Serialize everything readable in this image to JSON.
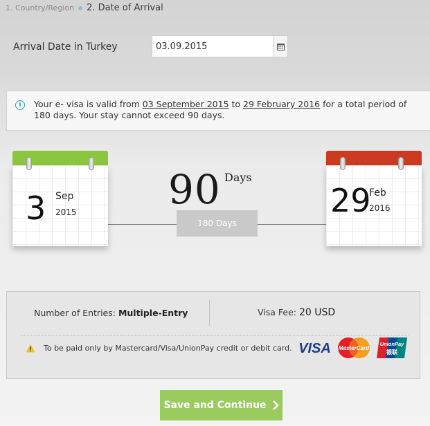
{
  "steps": {
    "step1": "1. Country/Region",
    "step2": "2. Date of Arrival"
  },
  "arrival": {
    "label": "Arrival Date in Turkey",
    "value": "03.09.2015"
  },
  "info": {
    "prefix": "Your e- visa is valid from ",
    "from_date": "03 September 2015",
    "middle": " to ",
    "to_date": "29 February 2016",
    "suffix": " for a total period of 180 days. Your stay cannot exceed 90 days."
  },
  "start_date": {
    "day": "3",
    "month": "Sep",
    "year": "2015",
    "header_color": "#8cc63f"
  },
  "end_date": {
    "day": "29",
    "month": "Feb",
    "year": "2016",
    "header_color": "#cc3a22"
  },
  "duration": {
    "stay_days": "90",
    "stay_unit": "Days",
    "total_period": "180 Days"
  },
  "visa": {
    "entries_label": "Number of Entries:",
    "entries_value": "Multiple-Entry",
    "fee_label": "Visa Fee:",
    "fee_value": "20 USD"
  },
  "payment": {
    "note": "To be paid only by Mastercard/Visa/UnionPay credit or debit card.",
    "cards": [
      "visa-logo",
      "mastercard-logo",
      "unionpay-logo"
    ]
  },
  "actions": {
    "save_label": "Save and Continue"
  },
  "colors": {
    "accent_teal": "#2ea5ac",
    "button_green": "#9bcb5f"
  }
}
